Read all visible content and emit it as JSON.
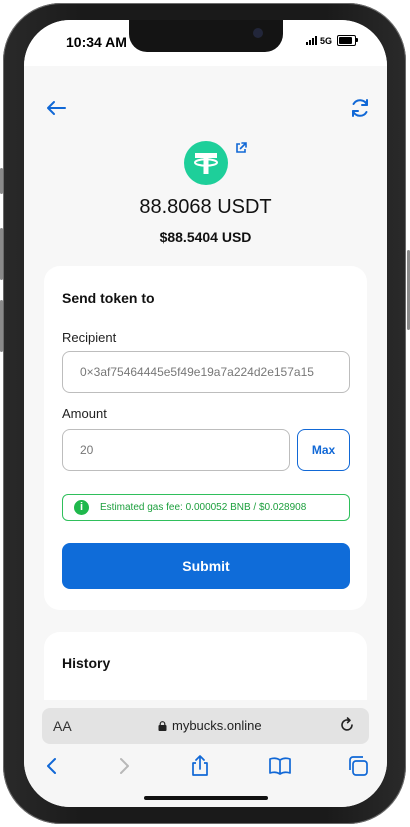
{
  "status_bar": {
    "time": "10:34 AM",
    "network": "5G"
  },
  "token": {
    "balance": "88.8068 USDT",
    "fiat_value": "$88.5404 USD",
    "logo_color": "#1ecf9a"
  },
  "send_form": {
    "title": "Send token to",
    "recipient_label": "Recipient",
    "recipient_value": "0×3af75464445e5f49e19a7a224d2e157a15",
    "amount_label": "Amount",
    "amount_value": "20",
    "max_label": "Max",
    "gas_fee_text": "Estimated gas fee: 0.000052  BNB / $0.028908",
    "submit_label": "Submit"
  },
  "history": {
    "title": "History"
  },
  "browser": {
    "aa_label": "AA",
    "url": "mybucks.online"
  },
  "colors": {
    "accent": "#0f6cd9",
    "success": "#1fb84c"
  }
}
